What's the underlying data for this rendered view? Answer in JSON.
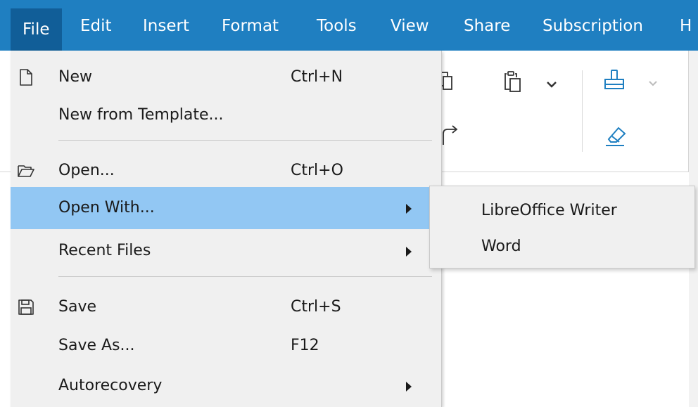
{
  "menubar": {
    "items": [
      {
        "label": "File",
        "active": true
      },
      {
        "label": "Edit"
      },
      {
        "label": "Insert"
      },
      {
        "label": "Format"
      },
      {
        "label": "Tools"
      },
      {
        "label": "View"
      },
      {
        "label": "Share"
      },
      {
        "label": "Subscription"
      },
      {
        "label": "H"
      }
    ],
    "color": "#1f7fc1",
    "active_color": "#115e98"
  },
  "toolbar": {
    "icons": [
      "copy-icon",
      "paste-icon",
      "chevron-down-icon",
      "format-painter-icon",
      "chevron-down-icon",
      "redo-icon",
      "eraser-icon"
    ]
  },
  "file_menu": {
    "items": [
      {
        "label": "New",
        "shortcut": "Ctrl+N",
        "icon": "new-document-icon"
      },
      {
        "label": "New from Template...",
        "shortcut": ""
      },
      {
        "label": "Open...",
        "shortcut": "Ctrl+O",
        "icon": "folder-open-icon"
      },
      {
        "label": "Open With...",
        "shortcut": "",
        "submenu": true,
        "highlighted": true
      },
      {
        "label": "Recent Files",
        "shortcut": "",
        "submenu": true
      },
      {
        "label": "Save",
        "shortcut": "Ctrl+S",
        "icon": "save-icon"
      },
      {
        "label": "Save As...",
        "shortcut": "F12"
      },
      {
        "label": "Autorecovery",
        "shortcut": "",
        "submenu": true
      }
    ],
    "highlight_color": "#92c7f3"
  },
  "open_with_submenu": {
    "items": [
      {
        "label": "LibreOffice Writer"
      },
      {
        "label": "Word"
      }
    ]
  }
}
